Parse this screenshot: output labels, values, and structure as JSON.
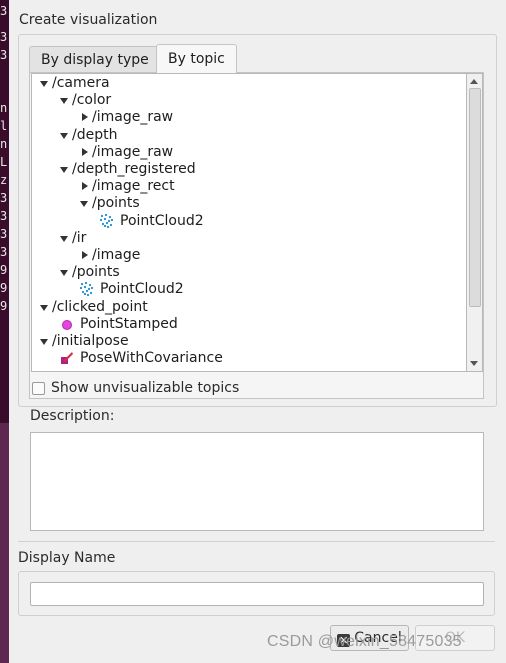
{
  "terminal": {
    "glyphs": [
      "3",
      "3",
      "3",
      "",
      "n",
      "l",
      "n",
      "L",
      "z",
      "3",
      "3",
      "3",
      "3",
      "9",
      "9",
      "9"
    ]
  },
  "dialog": {
    "title": "Create visualization",
    "tabs": [
      {
        "label": "By display type",
        "active": false
      },
      {
        "label": "By topic",
        "active": true
      }
    ],
    "tree": [
      {
        "label": "/camera",
        "expanded": true,
        "level": 0,
        "icon": "chevron-down-icon"
      },
      {
        "label": "/color",
        "expanded": true,
        "level": 1,
        "icon": "chevron-down-icon"
      },
      {
        "label": "/image_raw",
        "expanded": false,
        "level": 2,
        "icon": "chevron-right-icon"
      },
      {
        "label": "/depth",
        "expanded": true,
        "level": 1,
        "icon": "chevron-down-icon"
      },
      {
        "label": "/image_raw",
        "expanded": false,
        "level": 2,
        "icon": "chevron-right-icon"
      },
      {
        "label": "/depth_registered",
        "expanded": true,
        "level": 1,
        "icon": "chevron-down-icon"
      },
      {
        "label": "/image_rect",
        "expanded": false,
        "level": 2,
        "icon": "chevron-right-icon"
      },
      {
        "label": "/points",
        "expanded": true,
        "level": 2,
        "icon": "chevron-down-icon"
      },
      {
        "label": "PointCloud2",
        "level": 3,
        "icon": "pointcloud-icon"
      },
      {
        "label": "/ir",
        "expanded": true,
        "level": 1,
        "icon": "chevron-down-icon"
      },
      {
        "label": "/image",
        "expanded": false,
        "level": 2,
        "icon": "chevron-right-icon"
      },
      {
        "label": "/points",
        "expanded": true,
        "level": 1,
        "icon": "chevron-down-icon"
      },
      {
        "label": "PointCloud2",
        "level": 2,
        "icon": "pointcloud-icon"
      },
      {
        "label": "/clicked_point",
        "expanded": true,
        "level": 0,
        "icon": "chevron-down-icon"
      },
      {
        "label": "PointStamped",
        "level": 1,
        "icon": "point-icon"
      },
      {
        "label": "/initialpose",
        "expanded": true,
        "level": 0,
        "icon": "chevron-down-icon"
      },
      {
        "label": "PoseWithCovariance",
        "level": 1,
        "icon": "pose-icon"
      }
    ],
    "show_unvisualizable_label": "Show unvisualizable topics",
    "show_unvisualizable_checked": false,
    "description_label": "Description:",
    "description_value": "",
    "display_name_label": "Display Name",
    "display_name_value": "",
    "cancel_label": "Cancel",
    "ok_label": "OK",
    "ok_enabled": false,
    "colors": {
      "point_icon": "#e844e0",
      "pointcloud_icon": "#1a8cd8",
      "pose_icon": "#d0304a"
    }
  },
  "watermark": "CSDN @weixin_58475035"
}
